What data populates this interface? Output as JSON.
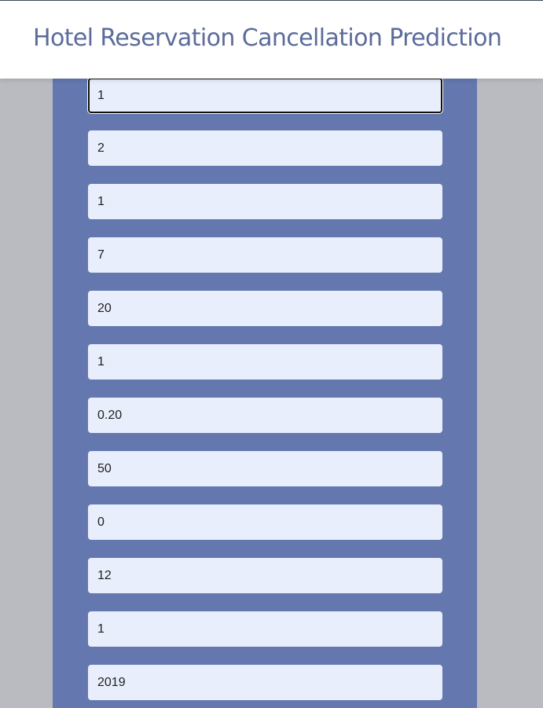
{
  "header": {
    "title": "Hotel Reservation Cancellation Prediction"
  },
  "form": {
    "fields": [
      {
        "value": "1"
      },
      {
        "value": "2"
      },
      {
        "value": "1"
      },
      {
        "value": "7"
      },
      {
        "value": "20"
      },
      {
        "value": "1"
      },
      {
        "value": "0.20"
      },
      {
        "value": "50"
      },
      {
        "value": "0"
      },
      {
        "value": "12"
      },
      {
        "value": "1"
      },
      {
        "value": "2019"
      }
    ]
  },
  "colors": {
    "background": "#b9bbc0",
    "panel": "#6478af",
    "field": "#e8eefb",
    "title": "#5b6b9b"
  }
}
